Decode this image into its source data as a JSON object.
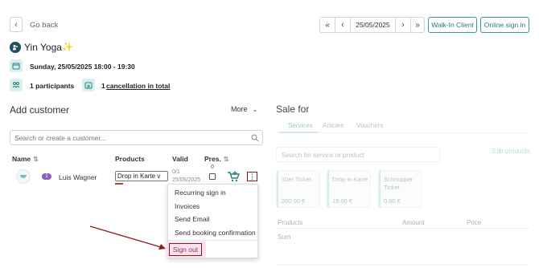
{
  "header": {
    "back_label": "Go back",
    "date_value": "25/05/2025",
    "nav_first": "«",
    "nav_prev": "‹",
    "nav_next": "›",
    "nav_last": "»",
    "walk_in_label": "Walk-In Client",
    "online_signin_label": "Online sign in"
  },
  "class": {
    "title": "Yin Yoga",
    "sparkle": "✨",
    "datetime": "Sunday, 25/05/2025 18:00 - 19:30",
    "participants": "1 participants",
    "cancellation_count": "1",
    "cancellation_link": "cancellation in total"
  },
  "add_customer": {
    "heading": "Add customer",
    "more_label": "More",
    "search_placeholder": "Search or create a customer...",
    "columns": {
      "name": "Name",
      "products": "Products",
      "valid": "Valid",
      "pres": "Pres.",
      "pres_count": "0"
    },
    "row": {
      "badge": "1",
      "name": "Luis Wagner",
      "product": "Drop in Karte v",
      "valid_count": "0/1",
      "valid_date": "25/05/2025"
    }
  },
  "context_menu": {
    "items": [
      "Recurring sign in",
      "Invoices",
      "Send Email",
      "Send booking confirmation"
    ],
    "sign_out": "Sign out"
  },
  "sale": {
    "heading": "Sale for",
    "tabs": [
      "Services",
      "Articles",
      "Vouchers"
    ],
    "search_placeholder": "Search for service or product",
    "edit_products": "Edit products",
    "cards": [
      {
        "name": "10er Ticket",
        "price": "200.00 €"
      },
      {
        "name": "Drop in Karte",
        "price": "19.00 €"
      },
      {
        "name": "Schnupper Ticket",
        "price": "0.00 €"
      }
    ],
    "table": {
      "products": "Products",
      "amount": "Amount",
      "price": "Price",
      "sum": "Sum"
    }
  },
  "colors": {
    "teal": "#2a7f80",
    "accent_red": "#8b1a1a",
    "sign_out_text": "#a0285a"
  }
}
